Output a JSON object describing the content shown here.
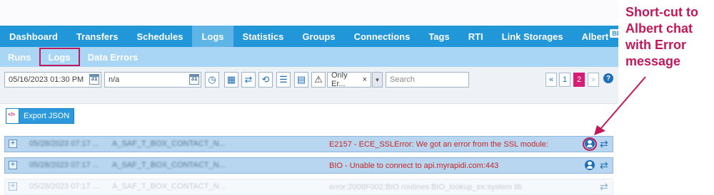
{
  "header": {
    "nav_items": [
      "Dashboard",
      "Transfers",
      "Schedules",
      "Logs",
      "Statistics",
      "Groups",
      "Connections",
      "Tags",
      "RTI",
      "Link Storages",
      "Albert"
    ],
    "beta_badge": "BETA"
  },
  "subnav": {
    "items": [
      "Runs",
      "Logs",
      "Data Errors"
    ]
  },
  "toolbar": {
    "date_from": "05/16/2023 01:30 PM",
    "date_to": "n/a",
    "calendar_day": "31",
    "filter_value": "Only Er...",
    "filter_clear": "×",
    "search_placeholder": "Search",
    "pagination": {
      "prev": "«",
      "pages": [
        "1",
        "2"
      ],
      "current": "2",
      "next": "»"
    },
    "help": "?"
  },
  "export": {
    "label": "Export JSON"
  },
  "log_rows": [
    {
      "timestamp": "05/28/2023 07:17 ...",
      "name": "A_SAF_T_BOX_CONTACT_N...",
      "message": "E2157 - ECE_SSLError: We got an error from the SSL module:"
    },
    {
      "timestamp": "05/28/2023 07:17 ...",
      "name": "A_SAF_T_BOX_CONTACT_N...",
      "message": "BIO - Unable to connect to api.myrapidi.com:443"
    },
    {
      "timestamp": "05/28/2023 07:17 ...",
      "name": "A_SAF_T_BOX_CONTACT_N...",
      "message": "error:2008F002:BIO routines:BIO_lookup_ex:system lib"
    }
  ],
  "annotation": {
    "text": "Short-cut to Albert chat with Error message"
  },
  "colors": {
    "nav_bg": "#2196d8",
    "subnav_bg": "#a8d6f4",
    "highlight": "#c2185b",
    "row_bg": "#b8d6ef",
    "error_text": "#c62828"
  }
}
